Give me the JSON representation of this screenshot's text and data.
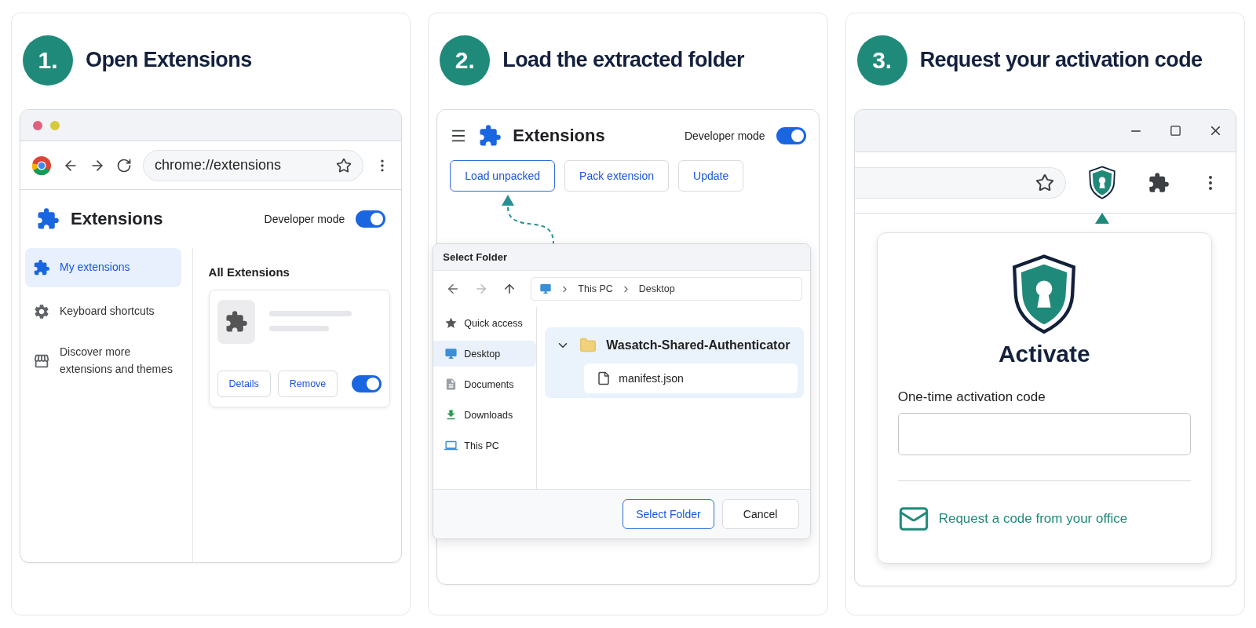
{
  "steps": [
    {
      "kind": "browser",
      "number": "1.",
      "title": "Open Extensions",
      "address": "chrome://extensions",
      "page_title": "Extensions",
      "developer_mode": {
        "label": "Developer mode",
        "on": true
      },
      "sidebar": [
        {
          "label": "My extensions",
          "selected": true
        },
        {
          "label": "Keyboard shortcuts",
          "selected": false
        },
        {
          "label": "Discover more extensions and themes",
          "selected": false
        }
      ],
      "section_title": "All Extensions",
      "extension_card": {
        "buttons": [
          "Details",
          "Remove"
        ],
        "enabled": true
      }
    },
    {
      "kind": "extensions",
      "number": "2.",
      "title": "Load the extracted folder",
      "page_title": "Extensions",
      "developer_mode": {
        "label": "Developer mode",
        "on": true
      },
      "buttons": [
        {
          "label": "Load unpacked",
          "selected": true
        },
        {
          "label": "Pack extension",
          "selected": false
        },
        {
          "label": "Update",
          "selected": false
        }
      ],
      "dialog": {
        "title": "Select Folder",
        "breadcrumb": [
          "This PC",
          "Desktop"
        ],
        "nav": [
          {
            "label": "Quick access",
            "selected": false
          },
          {
            "label": "Desktop",
            "selected": true
          },
          {
            "label": "Documents",
            "selected": false
          },
          {
            "label": "Downloads",
            "selected": false
          },
          {
            "label": "This PC",
            "selected": false
          }
        ],
        "folder": {
          "name": "Wasatch-Shared-Authenticator",
          "expanded": true,
          "selected": true,
          "children": [
            {
              "name": "manifest.json"
            }
          ]
        },
        "buttons": [
          {
            "label": "Select Folder",
            "primary": true
          },
          {
            "label": "Cancel",
            "primary": false
          }
        ]
      }
    },
    {
      "kind": "popup",
      "number": "3.",
      "title": "Request your activation code",
      "popup": {
        "title": "Activate",
        "field_label": "One-time activation code",
        "link": "Request a code from your office"
      }
    }
  ]
}
